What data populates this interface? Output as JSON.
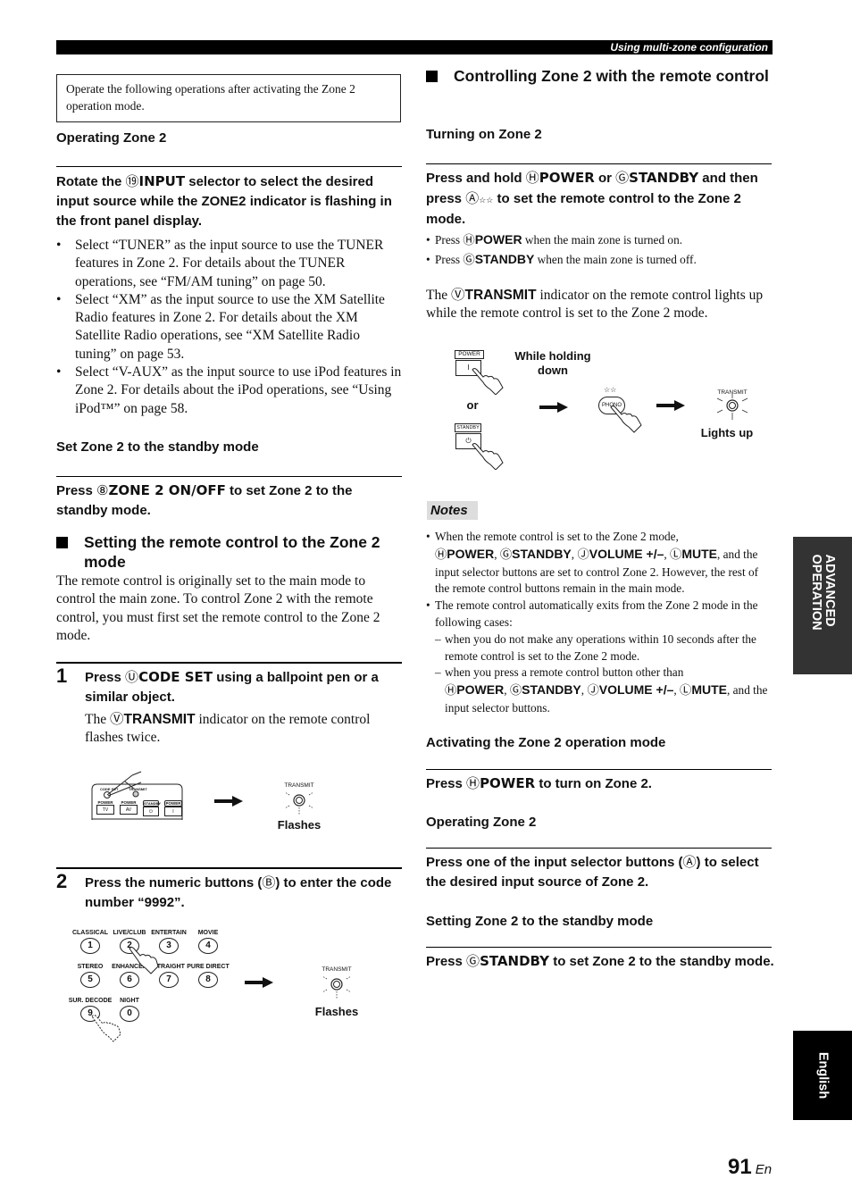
{
  "header": {
    "title": "Using multi-zone configuration"
  },
  "side_tabs": {
    "advanced": "ADVANCED OPERATION",
    "language": "English"
  },
  "page": {
    "number": "91",
    "lang_suffix": "En"
  },
  "left": {
    "notice": "Operate the following operations after activating the Zone 2 operation mode.",
    "operating_zone2": {
      "heading": "Operating Zone 2",
      "instruction_pre": "Rotate the ",
      "instruction_circ": "⑲",
      "instruction_key": "INPUT",
      "instruction_post": " selector to select the desired input source while the ZONE2 indicator is flashing in the front panel display.",
      "bullets": [
        "Select “TUNER” as the input source to use the TUNER features in Zone 2. For details about the TUNER operations, see “FM/AM tuning” on page 50.",
        "Select “XM” as the input source to use the XM Satellite Radio features in Zone 2. For details about the XM Satellite Radio operations, see “XM Satellite Radio tuning” on page 53.",
        "Select “V-AUX” as the input source to use iPod features in Zone 2. For details about the iPod operations, see “Using iPod™” on page 58."
      ]
    },
    "standby": {
      "heading": "Set Zone 2 to the standby mode",
      "instruction_pre": "Press ",
      "instruction_circ": "⑧",
      "instruction_key": "ZONE 2 ON/OFF",
      "instruction_post": " to set Zone 2 to the standby mode."
    },
    "setting_remote": {
      "heading": "Setting the remote control to the Zone 2 mode",
      "body": "The remote control is originally set to the main mode to control the main zone. To control Zone 2 with the remote control, you must first set the remote control to the Zone 2 mode.",
      "step1": {
        "num": "1",
        "pre": "Press ",
        "circ": "Ⓤ",
        "key": "CODE SET",
        "post": " using a ballpoint pen or a similar object.",
        "desc_pre": "The ",
        "desc_circ": "Ⓥ",
        "desc_key": "TRANSMIT",
        "desc_post": " indicator on the remote control flashes twice.",
        "diagram": {
          "button_labels": [
            "POWER",
            "POWER",
            "STANDBY",
            "POWER"
          ],
          "button_faces": [
            "TV",
            "AV",
            "⏻",
            "I"
          ],
          "code_set_label": "CODE SET",
          "transmit_label": "TRANSMIT",
          "result_label": "Flashes"
        }
      },
      "step2": {
        "num": "2",
        "pre": "Press the numeric buttons (",
        "circ": "Ⓑ",
        "post": ") to enter the code number “9992”.",
        "diagram": {
          "keys": [
            {
              "label": "CLASSICAL",
              "num": "1"
            },
            {
              "label": "LIVE/CLUB",
              "num": "2"
            },
            {
              "label": "ENTERTAIN",
              "num": "3"
            },
            {
              "label": "MOVIE",
              "num": "4"
            },
            {
              "label": "STEREO",
              "num": "5"
            },
            {
              "label": "ENHANCER",
              "num": "6"
            },
            {
              "label": "STRAIGHT",
              "num": "7"
            },
            {
              "label": "PURE DIRECT",
              "num": "8"
            },
            {
              "label": "SUR. DECODE",
              "num": "9"
            },
            {
              "label": "NIGHT",
              "num": "0"
            }
          ],
          "transmit_label": "TRANSMIT",
          "result_label": "Flashes"
        }
      }
    }
  },
  "right": {
    "controlling": {
      "heading": "Controlling Zone 2 with the remote control",
      "turning_on": {
        "heading": "Turning on Zone 2",
        "instr_1": "Press and hold ",
        "circ_h": "Ⓗ",
        "key_power": "POWER",
        "instr_or": " or ",
        "circ_g": "Ⓖ",
        "key_standby": "STANDBY",
        "instr_2": " and then press ",
        "circ_a": "Ⓐ",
        "stars": "☆☆",
        "instr_3": " to set the remote control to the Zone 2 mode.",
        "bullets": [
          {
            "pre": "Press ",
            "circ": "Ⓗ",
            "key": "POWER",
            "post": " when the main zone is turned on."
          },
          {
            "pre": "Press ",
            "circ": "Ⓖ",
            "key": "STANDBY",
            "post": " when the main zone is turned off."
          }
        ],
        "desc_pre": "The ",
        "desc_circ": "Ⓥ",
        "desc_key": "TRANSMIT",
        "desc_post": " indicator on the remote control lights up while the remote control is set to the Zone 2 mode.",
        "diagram": {
          "power_label": "POWER",
          "power_face": "I",
          "standby_label": "STANDBY",
          "standby_face": "⏻",
          "while_holding": "While holding down",
          "or": "or",
          "phono_stars": "☆☆",
          "phono_label": "PHONO",
          "transmit_label": "TRANSMIT",
          "result_label": "Lights up"
        }
      },
      "notes": {
        "label": "Notes",
        "n1_pre": "When the remote control is set to the Zone 2 mode,",
        "n1_post": ", and the input selector buttons are set to control Zone 2. However, the rest of the remote control buttons remain in the main mode.",
        "n2": "The remote control automatically exits from the Zone 2 mode in the following cases:",
        "d1": "when you do not make any operations within 10 seconds after the remote control is set to the Zone 2 mode.",
        "d2_pre": "when you press a remote control button other than",
        "d2_post": ", and the input selector buttons.",
        "keys": [
          {
            "circ": "Ⓗ",
            "key": "POWER"
          },
          {
            "circ": "Ⓖ",
            "key": "STANDBY"
          },
          {
            "circ": "Ⓙ",
            "key": "VOLUME +/–"
          },
          {
            "circ": "Ⓛ",
            "key": "MUTE"
          }
        ]
      },
      "activating": {
        "heading": "Activating the Zone 2 operation mode",
        "pre": "Press ",
        "circ": "Ⓗ",
        "key": "POWER",
        "post": " to turn on Zone 2."
      },
      "operating": {
        "heading": "Operating Zone 2",
        "pre": "Press one of the input selector buttons (",
        "circ": "Ⓐ",
        "post": ") to select the desired input source of Zone 2."
      },
      "standby": {
        "heading": "Setting Zone 2 to the standby mode",
        "pre": "Press ",
        "circ": "Ⓖ",
        "key": "STANDBY",
        "post": " to set Zone 2 to the standby mode."
      }
    }
  }
}
